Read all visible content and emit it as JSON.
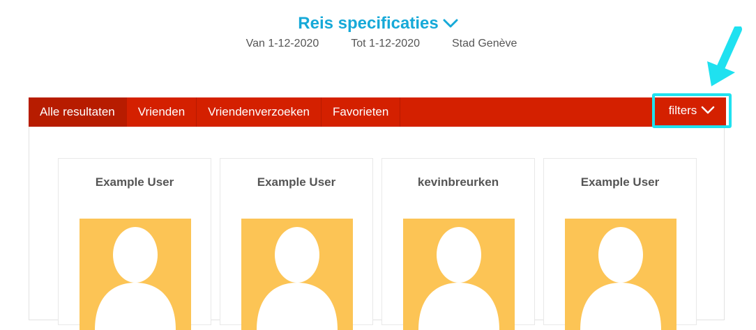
{
  "header": {
    "title": "Reis specificaties",
    "from": "Van 1-12-2020",
    "to": "Tot 1-12-2020",
    "city": "Stad Genève"
  },
  "tabs": [
    {
      "label": "Alle resultaten",
      "active": true
    },
    {
      "label": "Vrienden",
      "active": false
    },
    {
      "label": "Vriendenverzoeken",
      "active": false
    },
    {
      "label": "Favorieten",
      "active": false
    }
  ],
  "filters": {
    "label": "filters"
  },
  "users": [
    {
      "name": "Example User"
    },
    {
      "name": "Example User"
    },
    {
      "name": "kevinbreurken"
    },
    {
      "name": "Example User"
    }
  ],
  "colors": {
    "accent_blue": "#16a9d8",
    "tabbar_red": "#d42000",
    "tab_active": "#b71c00",
    "highlight_cyan": "#1fe1f0",
    "avatar_bg": "#fcc455"
  },
  "icons": {
    "title_chevron": "chevron-down-icon",
    "filters_chevron": "chevron-down-icon",
    "annotation": "annotation-arrow-icon",
    "avatar": "user-silhouette-icon"
  }
}
